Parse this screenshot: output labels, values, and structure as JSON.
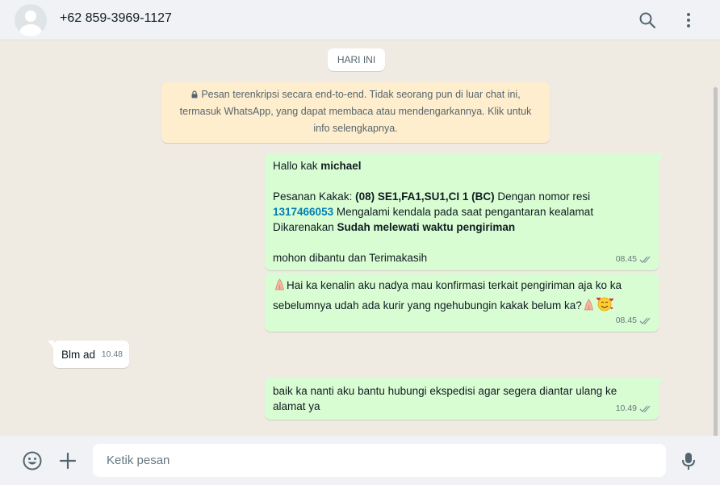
{
  "header": {
    "contact_name": "+62 859-3969-1127",
    "icons": [
      "search-icon",
      "menu-icon"
    ]
  },
  "chat": {
    "date_label": "HARI INI",
    "encryption_notice": "Pesan terenkripsi secara end-to-end. Tidak seorang pun di luar chat ini, termasuk WhatsApp, yang dapat membaca atau mendengarkannya. Klik untuk info selengkapnya.",
    "messages": [
      {
        "direction": "outgoing",
        "greeting": "Hallo kak ",
        "greeting_name": "michael",
        "order_prefix": "Pesanan Kakak: ",
        "order_items": "(08) SE1,FA1,SU1,CI 1 (BC)",
        "order_mid": " Dengan nomor resi ",
        "tracking_number": "1317466053",
        "order_issue": " Mengalami kendala pada saat pengantaran kealamat Dikarenakan ",
        "order_reason": "Sudah melewati waktu pengiriman",
        "closing": " mohon dibantu dan Terimakasih",
        "time": "08.45",
        "status": "read"
      },
      {
        "direction": "outgoing",
        "text": "Hai ka kenalin aku nadya mau konfirmasi terkait pengiriman aja ko ka sebelumnya udah ada kurir yang ngehubungin kakak belum ka?",
        "emojis": [
          "folded-hands-emoji",
          "folded-hands-emoji",
          "smiling-face-with-hearts-emoji"
        ],
        "time": "08.45",
        "status": "read"
      },
      {
        "direction": "incoming",
        "text": "Blm ad",
        "time": "10.48"
      },
      {
        "direction": "outgoing",
        "text": "baik ka nanti aku bantu hubungi ekspedisi agar segera diantar ulang ke alamat ya",
        "time": "10.49",
        "status": "read"
      }
    ]
  },
  "composer": {
    "placeholder": "Ketik pesan",
    "icons": [
      "emoji-icon",
      "plus-icon",
      "mic-icon"
    ]
  },
  "colors": {
    "outgoing_bubble": "#d9fdd3",
    "incoming_bubble": "#ffffff",
    "chat_background": "#efeae2",
    "notice_background": "#ffeecd",
    "link": "#027eb5",
    "read_tick": "#53bdeb",
    "meta_text": "#667781"
  }
}
